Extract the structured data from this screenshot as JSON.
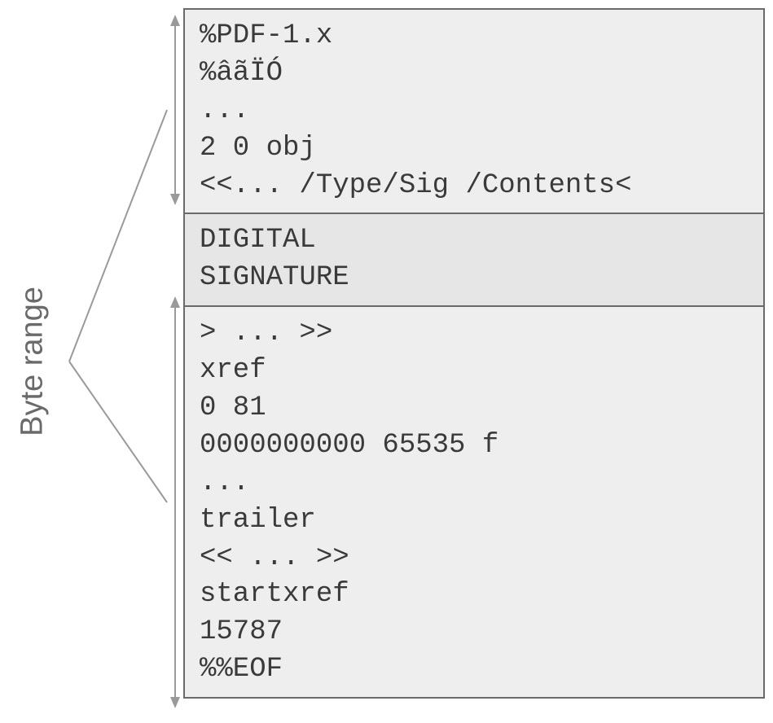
{
  "label": {
    "byte_range": "Byte range"
  },
  "file": {
    "top_lines": [
      "%PDF-1.x",
      "%âãÏÓ",
      "...",
      "2 0 obj",
      "<<... /Type/Sig /Contents<"
    ],
    "mid_lines": [
      "DIGITAL",
      "SIGNATURE"
    ],
    "bot_lines": [
      "> ... >>",
      "xref",
      "0 81",
      "0000000000 65535 f",
      "...",
      "trailer",
      "<< ... >>",
      "startxref",
      "15787",
      "%%EOF"
    ]
  }
}
